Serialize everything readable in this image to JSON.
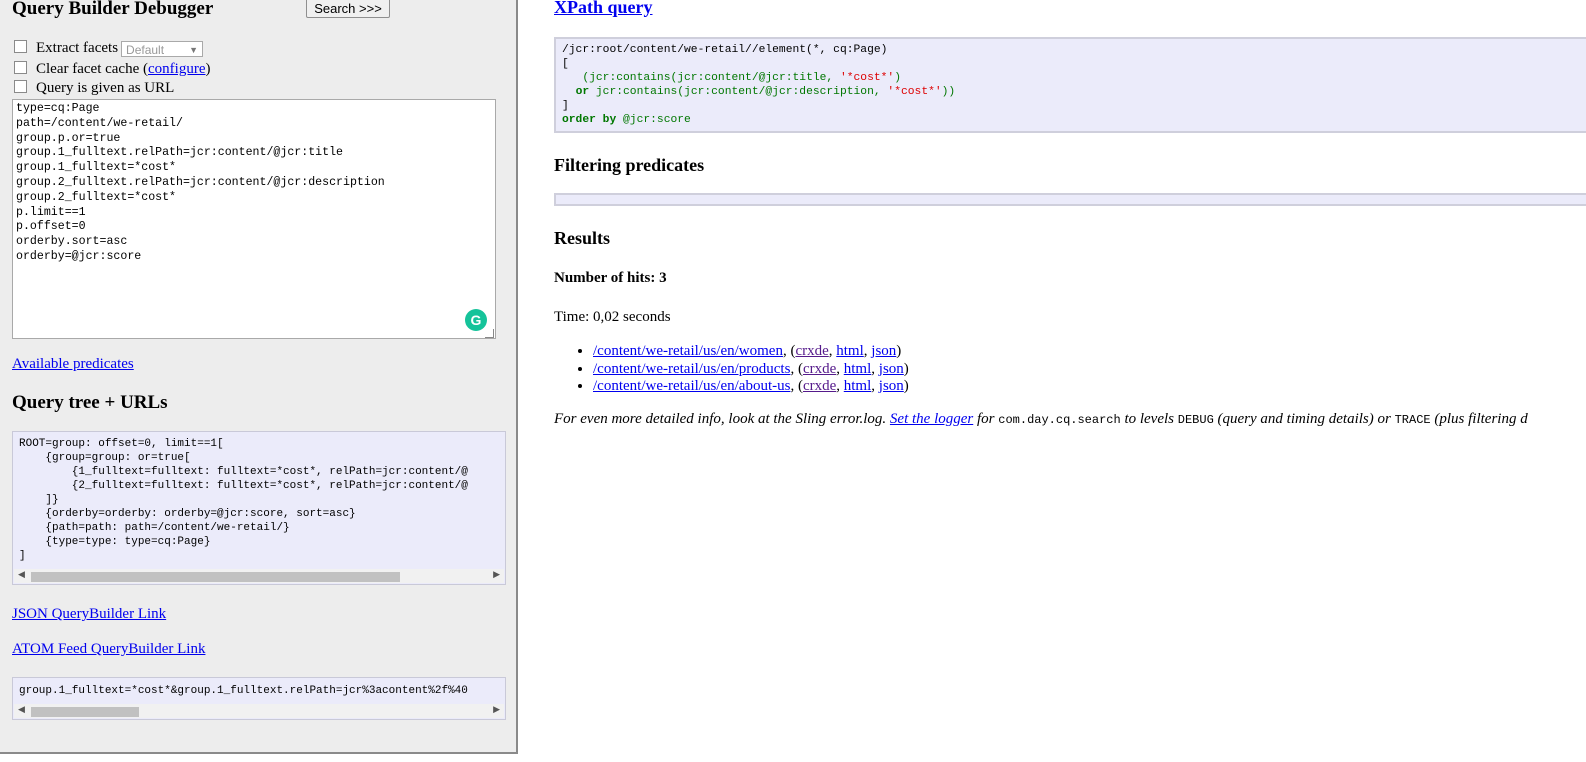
{
  "left": {
    "title": "Query Builder Debugger",
    "search_button": "Search >>>",
    "extract_facets_label": "Extract facets",
    "facet_select_value": "Default",
    "clear_cache_label": "Clear facet cache (",
    "clear_cache_link": "configure",
    "clear_cache_suffix": ")",
    "query_url_label": "Query is given as URL",
    "query_lines": [
      "type=cq:Page",
      "path=/content/we-retail/",
      "group.p.or=true",
      "group.1_fulltext.relPath=jcr:content/@jcr:title",
      "group.1_fulltext=*cost*",
      "group.2_fulltext.relPath=jcr:content/@jcr:description",
      "group.2_fulltext=*cost*",
      "p.limit==1",
      "p.offset=0",
      "orderby.sort=asc",
      "orderby=@jcr:score"
    ],
    "available_predicates": "Available predicates",
    "tree_title": "Query tree + URLs",
    "tree_text": "ROOT=group: offset=0, limit==1[\n    {group=group: or=true[\n        {1_fulltext=fulltext: fulltext=*cost*, relPath=jcr:content/@\n        {2_fulltext=fulltext: fulltext=*cost*, relPath=jcr:content/@\n    ]}\n    {orderby=orderby: orderby=@jcr:score, sort=asc}\n    {path=path: path=/content/we-retail/}\n    {type=type: type=cq:Page}\n]",
    "json_link": "JSON QueryBuilder Link",
    "atom_link": "ATOM Feed QueryBuilder Link",
    "url_text": "group.1_fulltext=*cost*&group.1_fulltext.relPath=jcr%3acontent%2f%40"
  },
  "right": {
    "xpath_link": "XPath query",
    "xpath": {
      "line1": "/jcr:root/content/we-retail//element(*, cq:Page)",
      "open": "[",
      "contains1_fn": "(jcr:contains(jcr:content/",
      "contains1_attr": "@jcr:title",
      "contains1_sep": ", ",
      "contains1_str": "'*cost*'",
      "contains1_close": ")",
      "or_kw": "or",
      "contains2_fn": "jcr:contains(jcr:content/",
      "contains2_attr": "@jcr:description",
      "contains2_sep": ", ",
      "contains2_str": "'*cost*'",
      "contains2_close": "))",
      "close": "]",
      "order_kw": "order by",
      "order_attr": "@jcr:score"
    },
    "filter_title": "Filtering predicates",
    "results_title": "Results",
    "hits": "Number of hits: 3",
    "time": "Time: 0,02 seconds",
    "results": [
      {
        "path": "/content/we-retail/us/en/women"
      },
      {
        "path": "/content/we-retail/us/en/products"
      },
      {
        "path": "/content/we-retail/us/en/about-us"
      }
    ],
    "result_links": {
      "crxde": "crxde",
      "html": "html",
      "json": "json"
    },
    "note": {
      "pre": "For even more detailed info, look at the Sling error.log. ",
      "link": "Set the logger",
      "mid1": " for ",
      "code1": "com.day.cq.search",
      "mid2": " to levels ",
      "code2": "DEBUG",
      "mid3": " (query and timing details) or ",
      "code3": "TRACE",
      "post": " (plus filtering d"
    }
  },
  "icons": {
    "grammarly": "grammarly-icon",
    "select_arrow": "chevron-down-icon"
  }
}
